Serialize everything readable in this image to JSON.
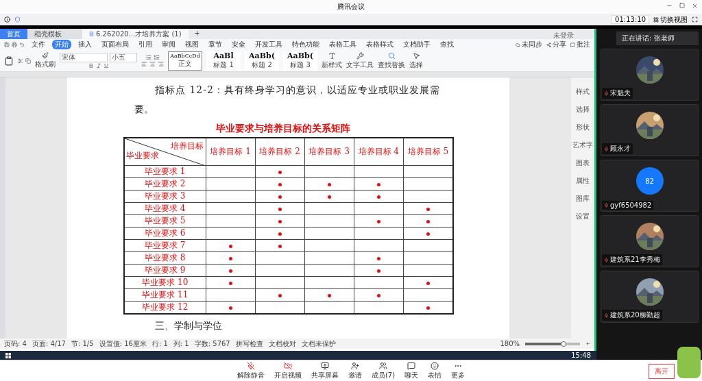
{
  "meeting": {
    "title": "腾讯会议",
    "timer": "01:13:10",
    "switch_view": "切换视图"
  },
  "wps": {
    "tabs": [
      {
        "label": "首页",
        "selected": false,
        "kind": "home"
      },
      {
        "label": "稻壳模板",
        "selected": false,
        "kind": "template"
      },
      {
        "label": "6.262020...才培养方案 (1)",
        "selected": true,
        "kind": "doc"
      }
    ],
    "account": "未登录",
    "menu": [
      {
        "label": "文件",
        "selected": false
      },
      {
        "label": "开始",
        "selected": true
      },
      {
        "label": "插入",
        "selected": false
      },
      {
        "label": "页面布局",
        "selected": false
      },
      {
        "label": "引用",
        "selected": false
      },
      {
        "label": "审阅",
        "selected": false
      },
      {
        "label": "视图",
        "selected": false
      },
      {
        "label": "章节",
        "selected": false
      },
      {
        "label": "安全",
        "selected": false
      },
      {
        "label": "开发工具",
        "selected": false
      },
      {
        "label": "特色功能",
        "selected": false
      },
      {
        "label": "表格工具",
        "selected": false
      },
      {
        "label": "表格样式",
        "selected": false
      },
      {
        "label": "文档助手",
        "selected": false
      },
      {
        "label": "查找",
        "selected": false
      }
    ],
    "menu_right": [
      "未同步",
      "分享",
      "批注"
    ],
    "ribbon": {
      "format_painter": "格式刷",
      "font": "宋体",
      "size": "小五",
      "styles": [
        {
          "preview": "AaBbCcDd",
          "label": "正文",
          "selected": true
        },
        {
          "preview": "AaBl",
          "label": "标题 1",
          "selected": false
        },
        {
          "preview": "AaBb(",
          "label": "标题 2",
          "selected": false
        },
        {
          "preview": "AaBb(",
          "label": "标题 3",
          "selected": false
        }
      ],
      "tools": [
        {
          "label": "新样式",
          "kind": "style"
        },
        {
          "label": "文字工具",
          "kind": "wrench"
        },
        {
          "label": "查找替换",
          "kind": "search"
        },
        {
          "label": "选择",
          "kind": "cursor"
        }
      ]
    },
    "side_tools": [
      "样式",
      "选择",
      "形状",
      "艺术字",
      "图表",
      "属性",
      "图库",
      "设置"
    ],
    "document": {
      "paragraph": "指标点 12-2：具有终身学习的意识，以适应专业或职业发展需",
      "paragraph_end": "要。",
      "table_title": "毕业要求与培养目标的关系矩阵",
      "matrix": {
        "corner_top": "培养目标",
        "corner_bottom": "毕业要求",
        "columns": [
          "培养目标 1",
          "培养目标 2",
          "培养目标 3",
          "培养目标 4",
          "培养目标 5"
        ],
        "rows": [
          {
            "label": "毕业要求 1",
            "cells": [
              {
                "marked": false
              },
              {
                "marked": true
              },
              {
                "marked": false
              },
              {
                "marked": false
              },
              {
                "marked": false
              }
            ]
          },
          {
            "label": "毕业要求 2",
            "cells": [
              {
                "marked": false
              },
              {
                "marked": true
              },
              {
                "marked": true
              },
              {
                "marked": true
              },
              {
                "marked": false
              }
            ]
          },
          {
            "label": "毕业要求 3",
            "cells": [
              {
                "marked": false
              },
              {
                "marked": true
              },
              {
                "marked": true
              },
              {
                "marked": true
              },
              {
                "marked": false
              }
            ]
          },
          {
            "label": "毕业要求 4",
            "cells": [
              {
                "marked": false
              },
              {
                "marked": true
              },
              {
                "marked": false
              },
              {
                "marked": false
              },
              {
                "marked": true
              }
            ]
          },
          {
            "label": "毕业要求 5",
            "cells": [
              {
                "marked": false
              },
              {
                "marked": true
              },
              {
                "marked": false
              },
              {
                "marked": true
              },
              {
                "marked": true
              }
            ]
          },
          {
            "label": "毕业要求 6",
            "cells": [
              {
                "marked": false
              },
              {
                "marked": true
              },
              {
                "marked": false
              },
              {
                "marked": false
              },
              {
                "marked": true
              }
            ]
          },
          {
            "label": "毕业要求 7",
            "cells": [
              {
                "marked": true
              },
              {
                "marked": true
              },
              {
                "marked": false
              },
              {
                "marked": false
              },
              {
                "marked": false
              }
            ]
          },
          {
            "label": "毕业要求 8",
            "cells": [
              {
                "marked": true
              },
              {
                "marked": false
              },
              {
                "marked": false
              },
              {
                "marked": true
              },
              {
                "marked": false
              }
            ]
          },
          {
            "label": "毕业要求 9",
            "cells": [
              {
                "marked": true
              },
              {
                "marked": false
              },
              {
                "marked": false
              },
              {
                "marked": true
              },
              {
                "marked": false
              }
            ]
          },
          {
            "label": "毕业要求 10",
            "cells": [
              {
                "marked": true
              },
              {
                "marked": false
              },
              {
                "marked": false
              },
              {
                "marked": false
              },
              {
                "marked": true
              }
            ]
          },
          {
            "label": "毕业要求 11",
            "cells": [
              {
                "marked": false
              },
              {
                "marked": true
              },
              {
                "marked": true
              },
              {
                "marked": true
              },
              {
                "marked": false
              }
            ]
          },
          {
            "label": "毕业要求 12",
            "cells": [
              {
                "marked": true
              },
              {
                "marked": false
              },
              {
                "marked": false
              },
              {
                "marked": false
              },
              {
                "marked": true
              }
            ]
          }
        ]
      },
      "section_heading": "三、学制与学位"
    },
    "status": [
      "页码: 4",
      "页面: 4/17",
      "节: 1/5",
      "设置值: 16厘米",
      "行: 1",
      "列: 1",
      "字数: 5767",
      "拼写检查",
      "文档校对",
      "文档未保护"
    ],
    "zoom": "180%",
    "zoom_slider": {
      "level": 0.7
    }
  },
  "taskbar": {
    "time": "15:48"
  },
  "participants": {
    "speaking": "正在讲话: 张老师",
    "tiles": [
      {
        "name": "宋魁夫",
        "kind": "picture"
      },
      {
        "name": "顾永才",
        "kind": "picture"
      },
      {
        "name": "gyf6504982",
        "kind": "initials",
        "initials": "82"
      },
      {
        "name": "建筑系21李秀梅",
        "kind": "picture"
      },
      {
        "name": "建筑系20柳勤超",
        "kind": "picture"
      }
    ]
  },
  "controls": [
    {
      "label": "解除静音",
      "kind": "mic"
    },
    {
      "label": "开启视频",
      "kind": "video"
    },
    {
      "label": "共享屏幕",
      "kind": "share"
    },
    {
      "label": "邀请",
      "kind": "invite"
    },
    {
      "label": "成员(7)",
      "kind": "members"
    },
    {
      "label": "聊天",
      "kind": "chat"
    },
    {
      "label": "表情",
      "kind": "emoji"
    },
    {
      "label": "更多",
      "kind": "more"
    }
  ],
  "leave": "离开"
}
